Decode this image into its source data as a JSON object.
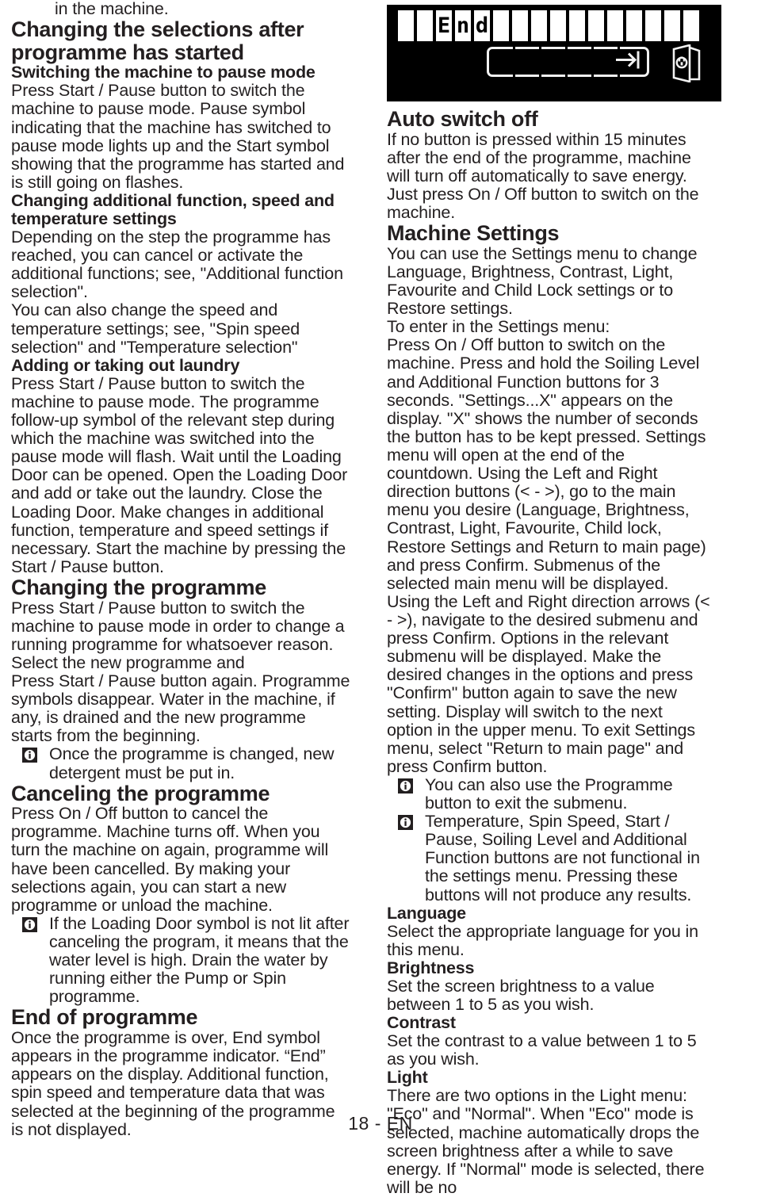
{
  "page": {
    "footer": "18 - EN"
  },
  "display_graphic": {
    "name": "lcd-display-end",
    "cells_total": 16,
    "text": "End",
    "text_start_cell": 3,
    "icons": [
      "progress-bar-icon",
      "arrow-to-end-icon",
      "door-lock-icon"
    ],
    "background_color": "#000000",
    "cell_color": "#ffffff"
  },
  "left_column": {
    "lead_text": "in the machine.",
    "heading_1": "Changing the selections after programme has started",
    "subheading_1": "Switching the machine to pause mode",
    "para_1": "Press Start / Pause button to switch the machine to pause mode. Pause symbol indicating that the machine has switched to pause mode lights up and the Start symbol showing that the programme has started and is still going on flashes.",
    "subheading_2": "Changing additional function, speed and temperature settings",
    "para_2": "Depending on the step the programme has reached, you can cancel or activate the additional functions; see,  \"Additional function selection\".",
    "para_3": "You can also change the speed and temperature settings; see, \"Spin speed selection\" and \"Temperature selection\"",
    "subheading_3": "Adding or taking out laundry",
    "para_4": "Press Start / Pause button to switch the machine to pause mode. The programme follow-up symbol of the relevant step during which the machine was switched into the pause mode will flash. Wait until the Loading Door can be opened. Open the Loading Door and add or take out the laundry. Close the Loading Door. Make changes in additional function, temperature and speed settings if necessary. Start the machine by pressing the Start / Pause button.",
    "heading_2": "Changing the programme",
    "para_5": "Press Start / Pause button to switch the machine to pause mode in order to change a running programme for whatsoever reason. Select the new programme and",
    "para_6": "Press Start / Pause button again. Programme symbols disappear. Water in the machine, if any, is drained and the new programme starts from the beginning.",
    "note_1": "Once the programme is changed, new detergent must be put in.",
    "heading_3": "Canceling the programme",
    "para_7": "Press On / Off button to cancel the programme. Machine turns off. When you turn the machine on again, programme will have been cancelled. By making your selections again, you can start a new programme or unload the machine.",
    "note_2": "If the Loading Door symbol is not lit after canceling the program, it means that the water level is high. Drain the water by running either the Pump or Spin programme.",
    "heading_4": "End of programme",
    "para_8": "Once the programme is over, End symbol appears in the programme indicator. “End” appears on the display. Additional function, spin speed and temperature data that was selected at the beginning of the programme is not displayed."
  },
  "right_column": {
    "heading_1": "Auto switch off",
    "para_1": "If no button is pressed within 15 minutes after the end of the programme, machine will turn off automatically to save energy. Just press On / Off button to switch on the machine.",
    "heading_2": "Machine Settings",
    "para_2": "You can use the Settings menu to change Language, Brightness, Contrast, Light, Favourite and Child Lock settings or to Restore settings.",
    "para_3": "To enter in the Settings menu:",
    "para_4": "Press On / Off button to switch on the machine. Press and hold the Soiling Level and Additional Function buttons for 3 seconds. \"Settings...X\" appears on the display. \"X\" shows the number of seconds the button has to be kept pressed. Settings menu will open at the end of the countdown. Using the Left and Right direction buttons (< - >), go to the main menu you desire (Language, Brightness, Contrast, Light, Favourite, Child lock, Restore Settings and Return to main page) and press Confirm. Submenus of the selected main menu will be displayed. Using the Left and Right direction arrows (< - >), navigate to the desired submenu and press Confirm. Options in the relevant submenu will be displayed. Make the desired changes in the options and press \"Confirm\" button again to save the new setting. Display will switch to the next option in the upper menu. To exit Settings menu, select \"Return to main page\" and press Confirm button.",
    "note_1": "You can also use the Programme button to exit the submenu.",
    "note_2": "Temperature, Spin Speed, Start / Pause, Soiling Level and Additional Function buttons are not functional in the settings menu. Pressing these buttons will not produce any results.",
    "heading_3": "Language",
    "para_5": "Select the appropriate language for you in this menu.",
    "heading_4": "Brightness",
    "para_6": "Set the screen brightness to a value between 1 to 5 as you wish.",
    "heading_5": "Contrast",
    "para_7": "Set the contrast to a value between 1 to 5 as you wish.",
    "heading_6": "Light",
    "para_8": "There are two options in the Light menu: \"Eco\" and \"Normal\". When \"Eco\" mode is selected, machine automatically drops the screen brightness after a while to save energy. If \"Normal\" mode is selected, there will be no"
  }
}
